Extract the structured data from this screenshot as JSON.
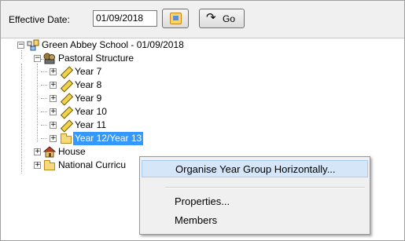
{
  "toolbar": {
    "effective_date_label": "Effective Date:",
    "date_value": "01/09/2018",
    "go_label": "Go"
  },
  "tree": {
    "root": "Green Abbey School - 01/09/2018",
    "pastoral": "Pastoral Structure",
    "years": [
      "Year  7",
      "Year  8",
      "Year  9",
      "Year 10",
      "Year 11"
    ],
    "year_12_13": "Year 12/Year 13",
    "house": "House",
    "national": "National Curricu"
  },
  "context_menu": {
    "items": [
      "Organise Year Group Horizontally...",
      "Properties...",
      "Members"
    ]
  },
  "colors": {
    "selection": "#3399ff",
    "menu_highlight": "#d5e6f8",
    "toolbar_bg": "#f0f0f0"
  }
}
